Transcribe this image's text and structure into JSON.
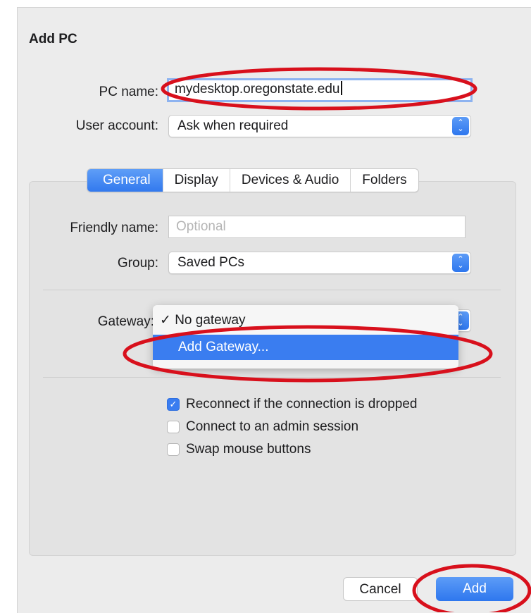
{
  "dialog": {
    "title": "Add PC"
  },
  "pc_name": {
    "label": "PC name:",
    "value": "mydesktop.oregonstate.edu"
  },
  "user_account": {
    "label": "User account:",
    "value": "Ask when required"
  },
  "tabs": [
    {
      "label": "General",
      "active": true
    },
    {
      "label": "Display",
      "active": false
    },
    {
      "label": "Devices & Audio",
      "active": false
    },
    {
      "label": "Folders",
      "active": false
    }
  ],
  "general": {
    "friendly_name": {
      "label": "Friendly name:",
      "placeholder": "Optional",
      "value": ""
    },
    "group": {
      "label": "Group:",
      "value": "Saved PCs"
    },
    "gateway": {
      "label": "Gateway:",
      "menu": [
        {
          "label": "No gateway",
          "checked": true,
          "check_glyph": "✓"
        },
        {
          "label": "Add Gateway...",
          "highlighted": true
        }
      ]
    },
    "checkboxes": [
      {
        "label": "Reconnect if the connection is dropped",
        "checked": true
      },
      {
        "label": "Connect to an admin session",
        "checked": false
      },
      {
        "label": "Swap mouse buttons",
        "checked": false
      }
    ]
  },
  "buttons": {
    "cancel": "Cancel",
    "add": "Add"
  },
  "colors": {
    "accent": "#3a7df0",
    "annotation": "#d8101c"
  },
  "icons": [
    "popup-stepper-icon",
    "checkmark-icon"
  ]
}
